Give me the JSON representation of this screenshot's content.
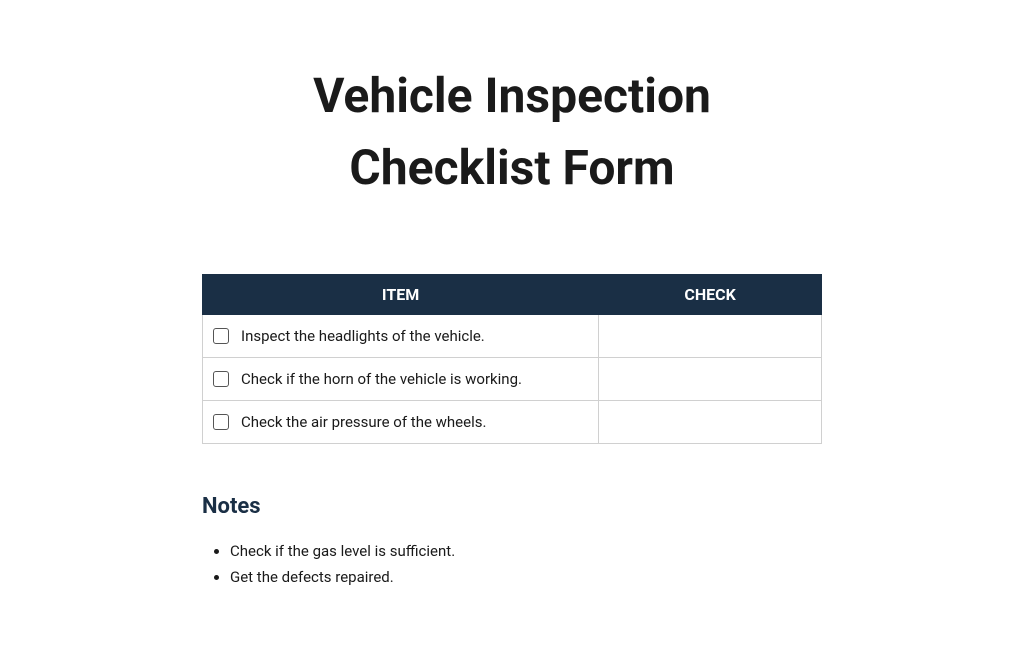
{
  "title": {
    "line1": "Vehicle Inspection",
    "line2": "Checklist Form"
  },
  "table": {
    "headers": {
      "item": "ITEM",
      "check": "CHECK"
    },
    "rows": [
      {
        "text": "Inspect the headlights of the vehicle."
      },
      {
        "text": "Check if the horn of the vehicle is working."
      },
      {
        "text": "Check the air pressure of the wheels."
      }
    ]
  },
  "notes": {
    "heading": "Notes",
    "items": [
      "Check if the gas level is sufficient.",
      "Get the defects repaired."
    ]
  }
}
